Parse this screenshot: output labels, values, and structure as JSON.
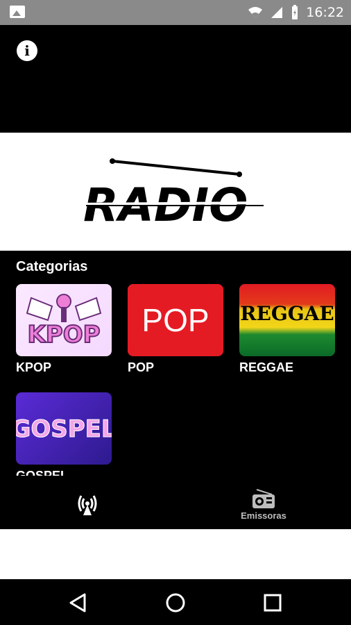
{
  "status_bar": {
    "time": "16:22"
  },
  "header": {
    "info_icon": "info-icon"
  },
  "banner": {
    "logo_text": "RADIO"
  },
  "categories": {
    "title": "Categorias",
    "items": [
      {
        "name": "KPOP",
        "art_text": "KPOP",
        "color": "#f4d9ff"
      },
      {
        "name": "POP",
        "art_text": "POP",
        "color": "#e51b24"
      },
      {
        "name": "REGGAE",
        "art_text": "REGGAE",
        "color": "#1d8a2f"
      },
      {
        "name": "GOSPEL",
        "art_text": "GOSPEL",
        "color": "#5a2bd6"
      }
    ]
  },
  "bottom_nav": {
    "items": [
      {
        "icon": "broadcast-tower-icon",
        "label": ""
      },
      {
        "icon": "radio-icon",
        "label": "Emissoras"
      }
    ]
  },
  "system_nav": {
    "back": "back-triangle-icon",
    "home": "home-circle-icon",
    "recents": "recents-square-icon"
  }
}
